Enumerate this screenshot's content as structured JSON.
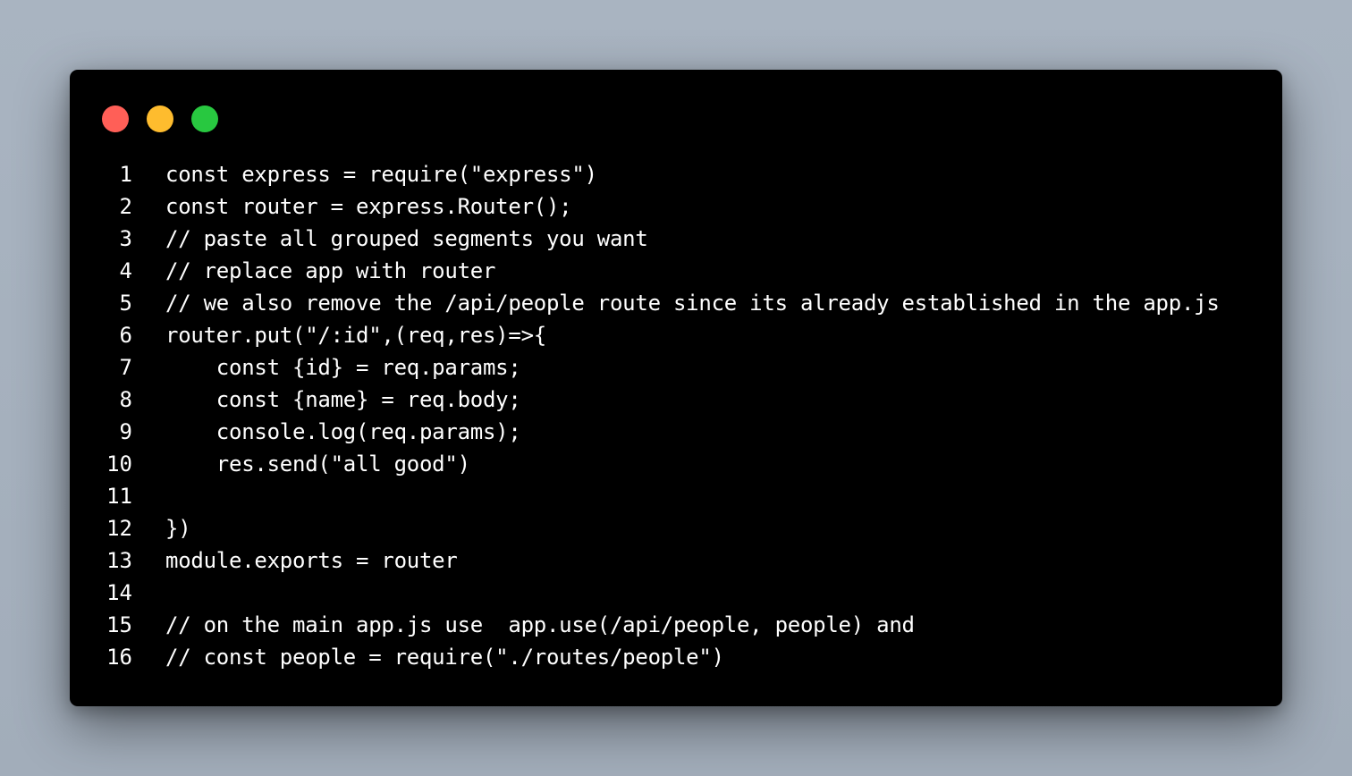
{
  "window": {
    "controls": [
      {
        "name": "close-button",
        "color": "#ff5f57"
      },
      {
        "name": "minimize-button",
        "color": "#febc2e"
      },
      {
        "name": "maximize-button",
        "color": "#28c840"
      }
    ]
  },
  "code": {
    "lines": [
      {
        "number": "1",
        "text": "const express = require(\"express\")"
      },
      {
        "number": "2",
        "text": "const router = express.Router();"
      },
      {
        "number": "3",
        "text": "// paste all grouped segments you want"
      },
      {
        "number": "4",
        "text": "// replace app with router"
      },
      {
        "number": "5",
        "text": "// we also remove the /api/people route since its already established in the app.js"
      },
      {
        "number": "6",
        "text": "router.put(\"/:id\",(req,res)=>{"
      },
      {
        "number": "7",
        "text": "    const {id} = req.params;"
      },
      {
        "number": "8",
        "text": "    const {name} = req.body;"
      },
      {
        "number": "9",
        "text": "    console.log(req.params);"
      },
      {
        "number": "10",
        "text": "    res.send(\"all good\")"
      },
      {
        "number": "11",
        "text": ""
      },
      {
        "number": "12",
        "text": "})"
      },
      {
        "number": "13",
        "text": "module.exports = router"
      },
      {
        "number": "14",
        "text": ""
      },
      {
        "number": "15",
        "text": "// on the main app.js use  app.use(/api/people, people) and"
      },
      {
        "number": "16",
        "text": "// const people = require(\"./routes/people\")"
      }
    ]
  }
}
